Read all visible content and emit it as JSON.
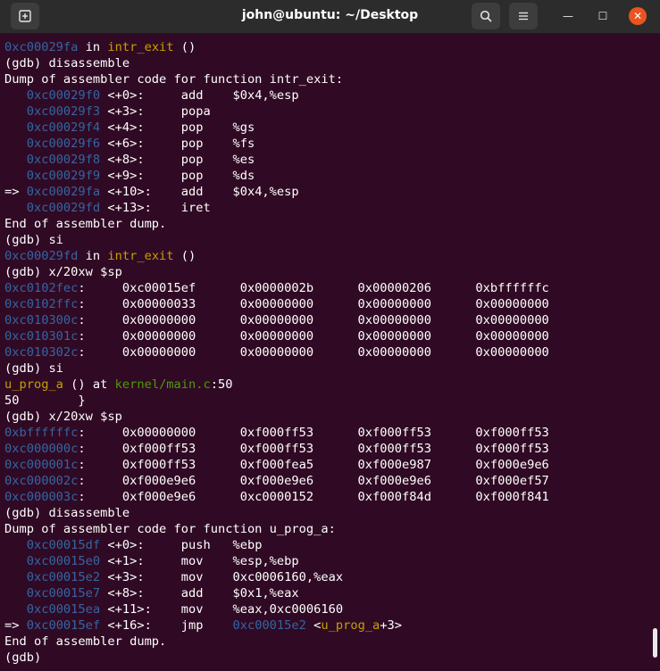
{
  "window": {
    "title": "john@ubuntu: ~/Desktop",
    "new_tab_icon": "new-tab-icon",
    "search_icon": "search-icon",
    "menu_icon": "hamburger-menu-icon",
    "minimize_glyph": "—",
    "maximize_glyph": "☐",
    "close_glyph": "✕"
  },
  "colors": {
    "background": "#300a24",
    "address": "#3465a4",
    "function": "#c4a000",
    "file": "#4e9a06",
    "close_button": "#e95420"
  },
  "terminal": {
    "lines": [
      [
        {
          "t": "0xc00029fa",
          "c": "addr"
        },
        {
          "t": " in "
        },
        {
          "t": "intr_exit",
          "c": "fn"
        },
        {
          "t": " ()"
        }
      ],
      [
        {
          "t": "(gdb) disassemble"
        }
      ],
      [
        {
          "t": "Dump of assembler code for function intr_exit:"
        }
      ],
      [
        {
          "t": "   "
        },
        {
          "t": "0xc00029f0",
          "c": "addr"
        },
        {
          "t": " <+0>:     add    $0x4,%esp"
        }
      ],
      [
        {
          "t": "   "
        },
        {
          "t": "0xc00029f3",
          "c": "addr"
        },
        {
          "t": " <+3>:     popa"
        }
      ],
      [
        {
          "t": "   "
        },
        {
          "t": "0xc00029f4",
          "c": "addr"
        },
        {
          "t": " <+4>:     pop    %gs"
        }
      ],
      [
        {
          "t": "   "
        },
        {
          "t": "0xc00029f6",
          "c": "addr"
        },
        {
          "t": " <+6>:     pop    %fs"
        }
      ],
      [
        {
          "t": "   "
        },
        {
          "t": "0xc00029f8",
          "c": "addr"
        },
        {
          "t": " <+8>:     pop    %es"
        }
      ],
      [
        {
          "t": "   "
        },
        {
          "t": "0xc00029f9",
          "c": "addr"
        },
        {
          "t": " <+9>:     pop    %ds"
        }
      ],
      [
        {
          "t": "=> "
        },
        {
          "t": "0xc00029fa",
          "c": "addr"
        },
        {
          "t": " <+10>:    add    $0x4,%esp"
        }
      ],
      [
        {
          "t": "   "
        },
        {
          "t": "0xc00029fd",
          "c": "addr"
        },
        {
          "t": " <+13>:    iret"
        }
      ],
      [
        {
          "t": "End of assembler dump."
        }
      ],
      [
        {
          "t": "(gdb) si"
        }
      ],
      [
        {
          "t": "0xc00029fd",
          "c": "addr"
        },
        {
          "t": " in "
        },
        {
          "t": "intr_exit",
          "c": "fn"
        },
        {
          "t": " ()"
        }
      ],
      [
        {
          "t": "(gdb) x/20xw $sp"
        }
      ],
      [
        {
          "t": "0xc0102fec",
          "c": "addr"
        },
        {
          "t": ":     0xc00015ef      0x0000002b      0x00000206      0xbffffffc"
        }
      ],
      [
        {
          "t": "0xc0102ffc",
          "c": "addr"
        },
        {
          "t": ":     0x00000033      0x00000000      0x00000000      0x00000000"
        }
      ],
      [
        {
          "t": "0xc010300c",
          "c": "addr"
        },
        {
          "t": ":     0x00000000      0x00000000      0x00000000      0x00000000"
        }
      ],
      [
        {
          "t": "0xc010301c",
          "c": "addr"
        },
        {
          "t": ":     0x00000000      0x00000000      0x00000000      0x00000000"
        }
      ],
      [
        {
          "t": "0xc010302c",
          "c": "addr"
        },
        {
          "t": ":     0x00000000      0x00000000      0x00000000      0x00000000"
        }
      ],
      [
        {
          "t": "(gdb) si"
        }
      ],
      [
        {
          "t": "u_prog_a",
          "c": "fn"
        },
        {
          "t": " () at "
        },
        {
          "t": "kernel/main.c",
          "c": "file"
        },
        {
          "t": ":50"
        }
      ],
      [
        {
          "t": "50        }"
        }
      ],
      [
        {
          "t": "(gdb) x/20xw $sp"
        }
      ],
      [
        {
          "t": "0xbffffffc",
          "c": "addr"
        },
        {
          "t": ":     0x00000000      0xf000ff53      0xf000ff53      0xf000ff53"
        }
      ],
      [
        {
          "t": "0xc000000c",
          "c": "addr"
        },
        {
          "t": ":     0xf000ff53      0xf000ff53      0xf000ff53      0xf000ff53"
        }
      ],
      [
        {
          "t": "0xc000001c",
          "c": "addr"
        },
        {
          "t": ":     0xf000ff53      0xf000fea5      0xf000e987      0xf000e9e6"
        }
      ],
      [
        {
          "t": "0xc000002c",
          "c": "addr"
        },
        {
          "t": ":     0xf000e9e6      0xf000e9e6      0xf000e9e6      0xf000ef57"
        }
      ],
      [
        {
          "t": "0xc000003c",
          "c": "addr"
        },
        {
          "t": ":     0xf000e9e6      0xc0000152      0xf000f84d      0xf000f841"
        }
      ],
      [
        {
          "t": "(gdb) disassemble"
        }
      ],
      [
        {
          "t": "Dump of assembler code for function u_prog_a:"
        }
      ],
      [
        {
          "t": "   "
        },
        {
          "t": "0xc00015df",
          "c": "addr"
        },
        {
          "t": " <+0>:     push   %ebp"
        }
      ],
      [
        {
          "t": "   "
        },
        {
          "t": "0xc00015e0",
          "c": "addr"
        },
        {
          "t": " <+1>:     mov    %esp,%ebp"
        }
      ],
      [
        {
          "t": "   "
        },
        {
          "t": "0xc00015e2",
          "c": "addr"
        },
        {
          "t": " <+3>:     mov    0xc0006160,%eax"
        }
      ],
      [
        {
          "t": "   "
        },
        {
          "t": "0xc00015e7",
          "c": "addr"
        },
        {
          "t": " <+8>:     add    $0x1,%eax"
        }
      ],
      [
        {
          "t": "   "
        },
        {
          "t": "0xc00015ea",
          "c": "addr"
        },
        {
          "t": " <+11>:    mov    %eax,0xc0006160"
        }
      ],
      [
        {
          "t": "=> "
        },
        {
          "t": "0xc00015ef",
          "c": "addr"
        },
        {
          "t": " <+16>:    jmp    "
        },
        {
          "t": "0xc00015e2",
          "c": "addr"
        },
        {
          "t": " <"
        },
        {
          "t": "u_prog_a",
          "c": "fn"
        },
        {
          "t": "+3>"
        }
      ],
      [
        {
          "t": "End of assembler dump."
        }
      ],
      [
        {
          "t": "(gdb)"
        }
      ]
    ]
  }
}
